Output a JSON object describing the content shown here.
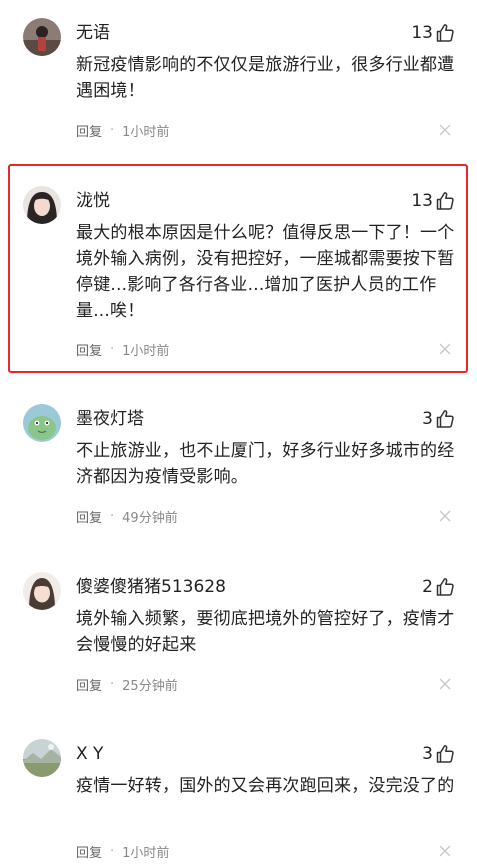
{
  "comments": [
    {
      "username": "无语",
      "likes": "13",
      "text": "新冠疫情影响的不仅仅是旅游行业，很多行业都遭遇困境！",
      "reply_label": "回复",
      "time": "1小时前"
    },
    {
      "username": "泷悦",
      "likes": "13",
      "text": "最大的根本原因是什么呢？值得反思一下了！一个境外输入病例，没有把控好，一座城都需要按下暂停键...影响了各行各业...增加了医护人员的工作量...唉！",
      "reply_label": "回复",
      "time": "1小时前"
    },
    {
      "username": "墨夜灯塔",
      "likes": "3",
      "text": "不止旅游业，也不止厦门，好多行业好多城市的经济都因为疫情受影响。",
      "reply_label": "回复",
      "time": "49分钟前"
    },
    {
      "username": "傻婆傻猪猪513628",
      "likes": "2",
      "text": "境外输入频繁，要彻底把境外的管控好了，疫情才会慢慢的好起来",
      "reply_label": "回复",
      "time": "25分钟前"
    },
    {
      "username": "X Y",
      "likes": "3",
      "text": "疫情一好转，国外的又会再次跑回来，没完没了的",
      "reply_label": "回复",
      "time": "1小时前"
    }
  ],
  "icons": {
    "like": "thumbs-up-icon",
    "dismiss": "close-icon"
  },
  "colors": {
    "highlight_border": "#e8262b",
    "text": "#222222",
    "meta": "#888888"
  }
}
